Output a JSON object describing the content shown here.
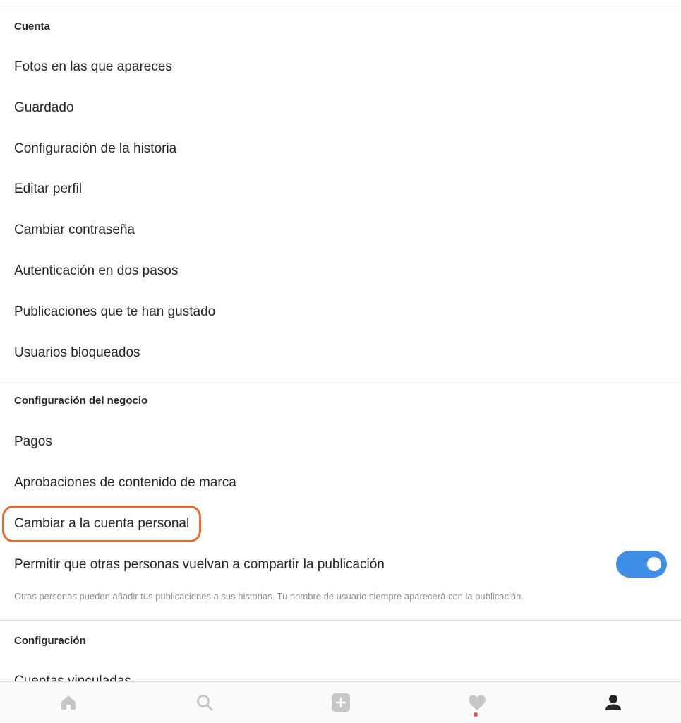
{
  "sections": {
    "account": {
      "header": "Cuenta",
      "items": [
        "Fotos en las que apareces",
        "Guardado",
        "Configuración de la historia",
        "Editar perfil",
        "Cambiar contraseña",
        "Autenticación en dos pasos",
        "Publicaciones que te han gustado",
        "Usuarios bloqueados"
      ]
    },
    "business": {
      "header": "Configuración del negocio",
      "items": [
        "Pagos",
        "Aprobaciones de contenido de marca",
        "Cambiar a la cuenta personal"
      ],
      "reshare": {
        "label": "Permitir que otras personas vuelvan a compartir la publicación",
        "enabled": true,
        "helper": "Otras personas pueden añadir tus publicaciones a sus historias. Tu nombre de usuario siempre aparecerá con la publicación."
      }
    },
    "settings": {
      "header": "Configuración",
      "items": [
        "Cuentas vinculadas"
      ]
    }
  },
  "tabbar": {
    "tabs": [
      {
        "icon": "home-icon"
      },
      {
        "icon": "search-icon"
      },
      {
        "icon": "add-post-icon"
      },
      {
        "icon": "heart-icon",
        "notification": true
      },
      {
        "icon": "profile-icon",
        "active": true
      }
    ]
  },
  "colors": {
    "highlight_outline": "#e86a33",
    "toggle_on": "#3f8ee8",
    "notification_dot": "#ed4956",
    "inactive_icon": "#c7c7c7",
    "active_icon": "#262626"
  }
}
